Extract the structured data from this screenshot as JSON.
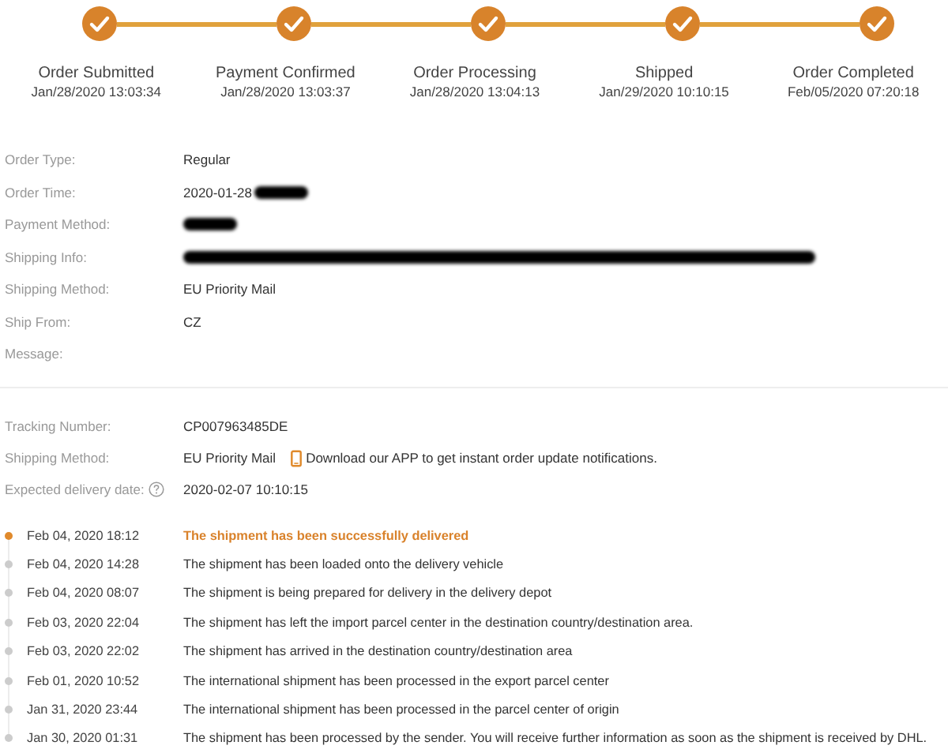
{
  "steps": [
    {
      "label": "Order Submitted",
      "time": "Jan/28/2020 13:03:34",
      "done": true
    },
    {
      "label": "Payment Confirmed",
      "time": "Jan/28/2020 13:03:37",
      "done": true
    },
    {
      "label": "Order Processing",
      "time": "Jan/28/2020 13:04:13",
      "done": true
    },
    {
      "label": "Shipped",
      "time": "Jan/29/2020 10:10:15",
      "done": true
    },
    {
      "label": "Order Completed",
      "time": "Feb/05/2020 07:20:18",
      "done": true
    }
  ],
  "order_info": [
    {
      "label": "Order Type:",
      "value": "Regular"
    },
    {
      "label": "Order Time:",
      "value": "2020-01-28",
      "redacted": true
    },
    {
      "label": "Payment Method:",
      "redacted": true
    },
    {
      "label": "Shipping Info:",
      "redacted": true
    },
    {
      "label": "Shipping Method:",
      "value": "EU Priority Mail"
    },
    {
      "label": "Ship From:",
      "value": "CZ"
    },
    {
      "label": "Message:"
    }
  ],
  "tracking": {
    "number_label": "Tracking Number:",
    "number": "CP007963485DE",
    "method_label": "Shipping Method:",
    "method": "EU Priority Mail",
    "app_notice": "Download our APP to get instant order update notifications.",
    "delivery_label": "Expected delivery date:",
    "delivery": "2020-02-07 10:10:15"
  },
  "events": [
    {
      "time": "Feb 04, 2020 18:12",
      "text": "The shipment has been successfully delivered",
      "current": true
    },
    {
      "time": "Feb 04, 2020 14:28",
      "text": "The shipment has been loaded onto the delivery vehicle",
      "current": false
    },
    {
      "time": "Feb 04, 2020 08:07",
      "text": "The shipment is being prepared for delivery in the delivery depot",
      "current": false
    },
    {
      "time": "Feb 03, 2020 22:04",
      "text": "The shipment has left the import parcel center in the destination country/destination area.",
      "current": false
    },
    {
      "time": "Feb 03, 2020 22:02",
      "text": "The shipment has arrived in the destination country/destination area",
      "current": false
    },
    {
      "time": "Feb 01, 2020 10:52",
      "text": "The international shipment has been processed in the export parcel center",
      "current": false
    },
    {
      "time": "Jan 31, 2020 23:44",
      "text": "The international shipment has been processed in the parcel center of origin",
      "current": false
    },
    {
      "time": "Jan 30, 2020 01:31",
      "text": "The shipment has been processed by the sender. You will receive further information as soon as the shipment is received by DHL.",
      "current": false
    }
  ]
}
